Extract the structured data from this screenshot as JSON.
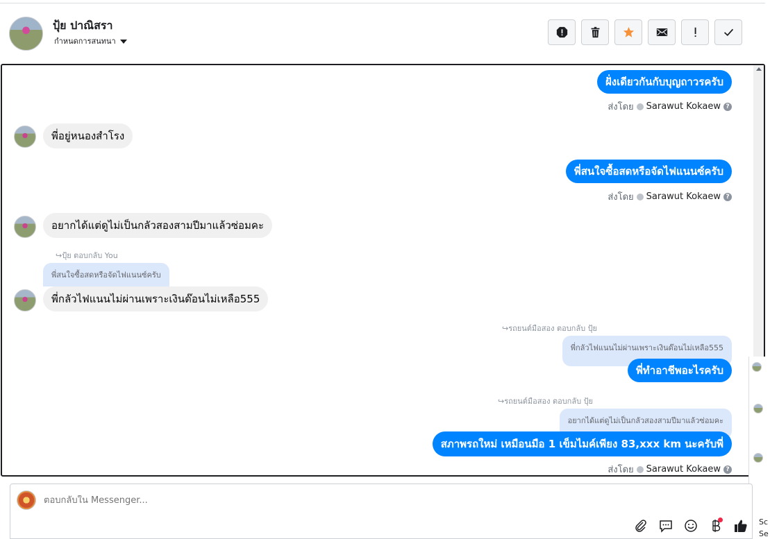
{
  "header": {
    "contact_name": "ปุ้ย ปาณิสรา",
    "assign_label": "กำหนดการสนทนา",
    "toolbar": [
      "spam-icon",
      "trash-icon",
      "star-icon",
      "mail-icon",
      "important-icon",
      "done-icon"
    ]
  },
  "messages": {
    "m1": {
      "text": "ฝั่งเดียวกันกับบุญถาวรครับ"
    },
    "s1": {
      "prefix": "ส่งโดย",
      "name": "Sarawut Kokaew"
    },
    "m2": {
      "text": "พี่อยู่หนองสำโรง"
    },
    "m3": {
      "text": "พี่สนใจซื้อสดหรือจัดไฟแนนซ์ครับ"
    },
    "s2": {
      "prefix": "ส่งโดย",
      "name": "Sarawut Kokaew"
    },
    "m4": {
      "text": "อยากได้แต่ดูไม่เป็นกลัวสองสามปีมาแล้วซ่อมคะ"
    },
    "r1": {
      "label": "↪ปุ้ย ตอบกลับ You",
      "quote": "พี่สนใจซื้อสดหรือจัดไฟแนนซ์ครับ"
    },
    "m5": {
      "text": "พี่กลัวไฟแนนไม่ผ่านเพราะเงินด๊อนไม่เหลือ555"
    },
    "r2": {
      "label": "↪รถยนต์มือสอง ตอบกลับ ปุ้ย",
      "quote": "พี่กลัวไฟแนนไม่ผ่านเพราะเงินด๊อนไม่เหลือ555"
    },
    "m6": {
      "text": "พี่ทำอาชีพอะไรครับ"
    },
    "r3": {
      "label": "↪รถยนต์มือสอง ตอบกลับ ปุ้ย",
      "quote": "อยากได้แต่ดูไม่เป็นกลัวสองสามปีมาแล้วซ่อมคะ"
    },
    "m7": {
      "text": "สภาพรถใหม่ เหมือนมือ 1 เข็มไมค์เพียง 83,xxx km นะครับพี่"
    },
    "s3": {
      "prefix": "ส่งโดย",
      "name": "Sarawut Kokaew"
    }
  },
  "side_panel": {
    "text_a": "Sc",
    "text_b": "Se"
  },
  "composer": {
    "placeholder": "ตอบกลับใน Messenger...",
    "tools": [
      "attach-icon",
      "saved-reply-icon",
      "emoji-icon",
      "payment-icon",
      "like-icon"
    ]
  },
  "colors": {
    "outgoing": "#0084ff",
    "incoming": "#f0f0f0",
    "quote": "#dbe7fb",
    "badge": "#f02849"
  }
}
